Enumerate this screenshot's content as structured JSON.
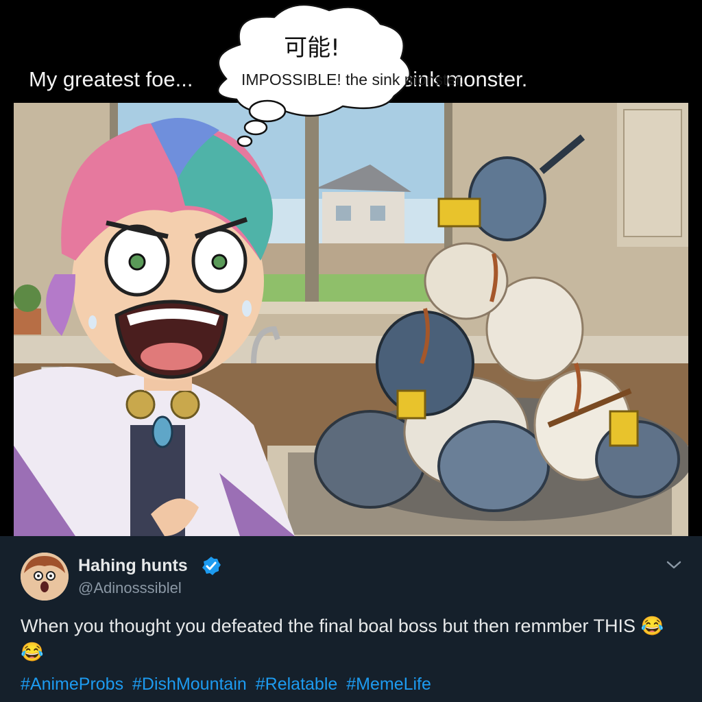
{
  "meme": {
    "caption_left": "My greatest foe...",
    "caption_right": "the sink monster.",
    "bubble_top": "可能!",
    "bubble_main": "IMPOSSIBLE! the sink monster."
  },
  "post": {
    "display_name": "Hahing hunts",
    "handle": "@Adinosssiblel",
    "text": "When you thought you defeated the final boal boss but then remmber THIS 😂😂",
    "hashtags": [
      "#AnimeProbs",
      "#DishMountain",
      "#Relatable",
      "#MemeLife"
    ],
    "icons": {
      "verified": "verified-badge-icon",
      "more": "chevron-down-icon"
    },
    "colors": {
      "background": "#15202b",
      "hashtag": "#1d9bf0",
      "verified": "#1d9bf0"
    }
  }
}
